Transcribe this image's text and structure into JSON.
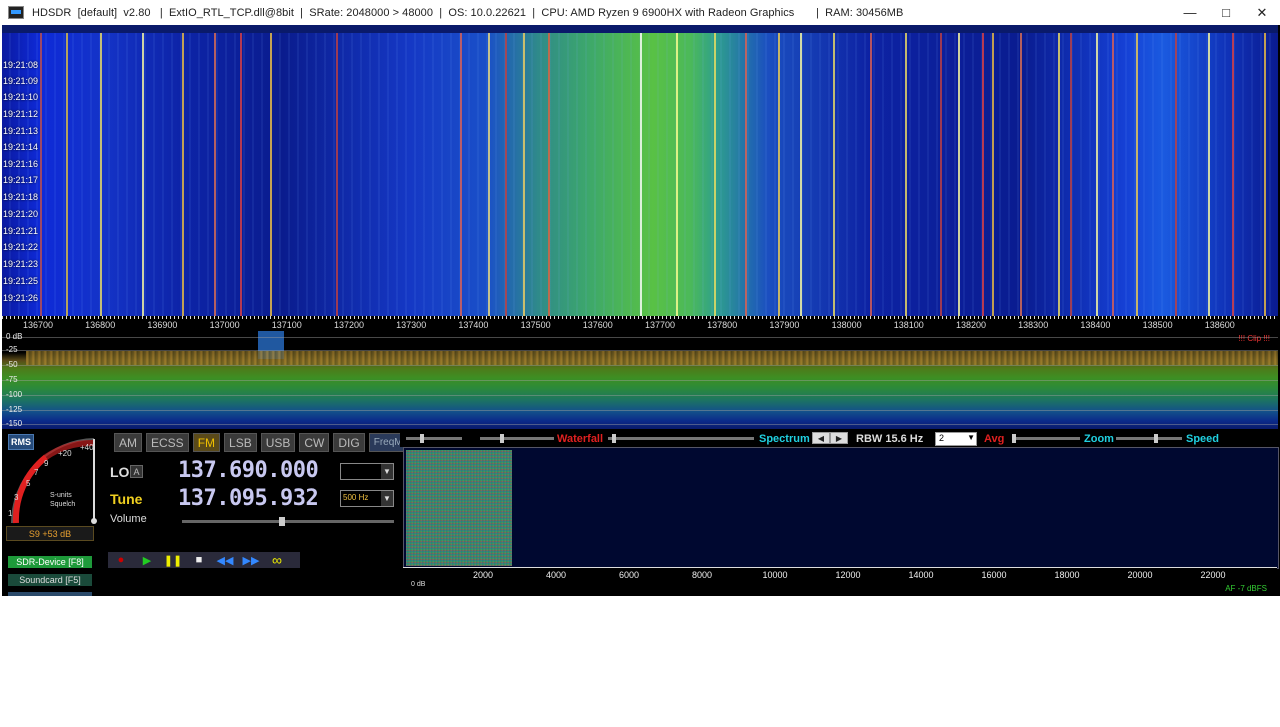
{
  "window": {
    "title": "HDSDR  [default]  v2.80   |  ExtIO_RTL_TCP.dll@8bit  |  SRate: 2048000 > 48000  |  OS: 10.0.22621  |  CPU: AMD Ryzen 9 6900HX with Radeon Graphics       |  RAM: 30456MB",
    "minimize_icon": "minimize-icon",
    "maximize_icon": "maximize-icon",
    "close_icon": "close-icon"
  },
  "waterfall": {
    "timestamps": [
      "19:21:08",
      "19:21:09",
      "19:21:10",
      "19:21:12",
      "19:21:13",
      "19:21:14",
      "19:21:16",
      "19:21:17",
      "19:21:18",
      "19:21:20",
      "19:21:21",
      "19:21:22",
      "19:21:23",
      "19:21:25",
      "19:21:26"
    ],
    "freq_ticks": [
      "136700",
      "136800",
      "136900",
      "137000",
      "137100",
      "137200",
      "137300",
      "137400",
      "137500",
      "137600",
      "137700",
      "137800",
      "137900",
      "138000",
      "138100",
      "138200",
      "138300",
      "138400",
      "138500",
      "138600"
    ]
  },
  "spectrum": {
    "db_labels": [
      "0 dB",
      "-25",
      "-50",
      "-75",
      "-100",
      "-125",
      "-150"
    ],
    "clip_text": "!!! Clip !!!"
  },
  "smeter": {
    "rms_label": "RMS",
    "scale": [
      "1",
      "3",
      "5",
      "7",
      "9",
      "+20",
      "+40"
    ],
    "units_label": "S-units",
    "squelch_label": "Squelch",
    "reading": "S9 +53 dB"
  },
  "left_buttons": {
    "sdr_device": "SDR-Device [F8]",
    "soundcard": "Soundcard [F5]"
  },
  "modes": [
    "AM",
    "ECSS",
    "FM",
    "LSB",
    "USB",
    "CW",
    "DIG"
  ],
  "active_mode": "FM",
  "freqmgr_label": "FreqMgr",
  "lo": {
    "label": "LO",
    "badge": "A",
    "frequency": "137.690.000"
  },
  "tune": {
    "label": "Tune",
    "frequency": "137.095.932",
    "step": "500 Hz"
  },
  "volume": {
    "label": "Volume",
    "level": 0.47
  },
  "transport_icons": [
    "record-icon",
    "play-icon",
    "pause-icon",
    "stop-icon",
    "rewind-icon",
    "fast-forward-icon",
    "loop-icon"
  ],
  "toolbar": {
    "waterfall_label": "Waterfall",
    "spectrum_label": "Spectrum",
    "rbw_label": "RBW 15.6 Hz",
    "avg_value": "2",
    "avg_label": "Avg",
    "zoom_label": "Zoom",
    "speed_label": "Speed"
  },
  "af": {
    "ticks": [
      "2000",
      "4000",
      "6000",
      "8000",
      "10000",
      "12000",
      "14000",
      "16000",
      "18000",
      "20000",
      "22000"
    ],
    "db_label": "0 dB",
    "level_label": "AF  -7 dBFS"
  },
  "colors": {
    "accent_red": "#e02020",
    "accent_cyan": "#20d0e0",
    "tune_yellow": "#f0d020"
  }
}
